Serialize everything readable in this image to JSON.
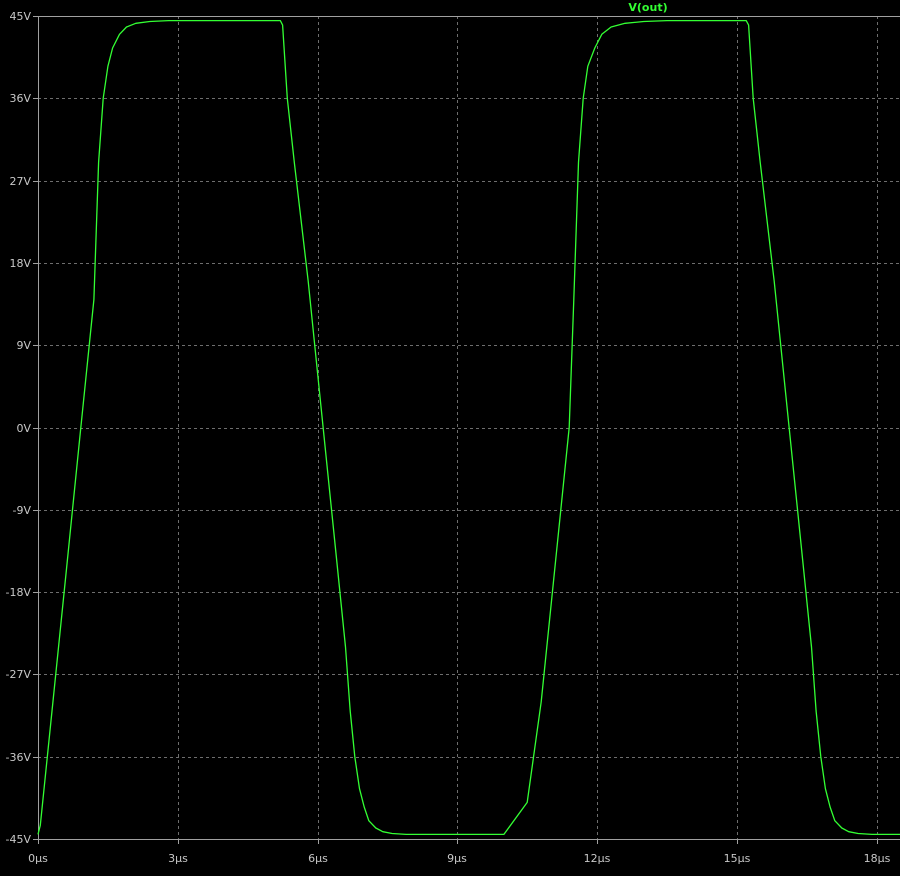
{
  "chart_data": {
    "type": "line",
    "title": "",
    "xlabel": "",
    "ylabel": "",
    "xlim": [
      0,
      18.5
    ],
    "ylim": [
      -45,
      45
    ],
    "x_ticks": [
      0,
      3,
      6,
      9,
      12,
      15,
      18
    ],
    "x_tick_labels": [
      "0µs",
      "3µs",
      "6µs",
      "9µs",
      "12µs",
      "15µs",
      "18µs"
    ],
    "y_ticks": [
      45,
      36,
      27,
      18,
      9,
      0,
      -9,
      -18,
      -27,
      -36,
      -45
    ],
    "y_tick_labels": [
      "45V",
      "36V",
      "27V",
      "18V",
      "9V",
      "0V",
      "-9V",
      "-18V",
      "-27V",
      "-36V",
      "-45V"
    ],
    "grid": true,
    "background_color": "#000000",
    "axis_color": "#a0a0a0",
    "grid_color": "#6e6e6e",
    "tick_label_color": "#c8c8c8",
    "series": [
      {
        "name": "V(out)",
        "color": "#33ff33",
        "x": [
          0,
          0.05,
          0.3,
          0.6,
          0.9,
          1.2,
          1.3,
          1.4,
          1.5,
          1.6,
          1.75,
          1.9,
          2.1,
          2.4,
          2.8,
          3.5,
          4.5,
          5.2,
          5.25,
          5.35,
          5.5,
          5.8,
          6.1,
          6.4,
          6.6,
          6.7,
          6.8,
          6.9,
          7.0,
          7.1,
          7.25,
          7.4,
          7.6,
          7.9,
          8.3,
          9.0,
          10.0,
          10.5,
          10.8,
          11.1,
          11.4,
          11.5,
          11.6,
          11.7,
          11.8,
          11.95,
          12.1,
          12.3,
          12.6,
          13.0,
          13.5,
          14.5,
          15.2,
          15.25,
          15.35,
          15.5,
          15.8,
          16.1,
          16.4,
          16.6,
          16.7,
          16.8,
          16.9,
          17.0,
          17.1,
          17.25,
          17.4,
          17.6,
          17.9,
          18.3,
          18.5
        ],
        "y": [
          -44.5,
          -43.5,
          -31,
          -16,
          -1,
          14,
          29,
          36,
          39.5,
          41.5,
          43,
          43.8,
          44.2,
          44.4,
          44.5,
          44.5,
          44.5,
          44.5,
          44,
          36,
          29,
          16,
          1,
          -14,
          -24,
          -31,
          -36,
          -39.5,
          -41.5,
          -43,
          -43.8,
          -44.2,
          -44.4,
          -44.5,
          -44.5,
          -44.5,
          -44.5,
          -41,
          -30,
          -15,
          0,
          14,
          29,
          36,
          39.5,
          41.5,
          43,
          43.8,
          44.2,
          44.4,
          44.5,
          44.5,
          44.5,
          44,
          36,
          29,
          16,
          1,
          -14,
          -24,
          -31,
          -36,
          -39.5,
          -41.5,
          -43,
          -43.8,
          -44.2,
          -44.4,
          -44.5,
          -44.5,
          -44.5
        ]
      }
    ]
  }
}
